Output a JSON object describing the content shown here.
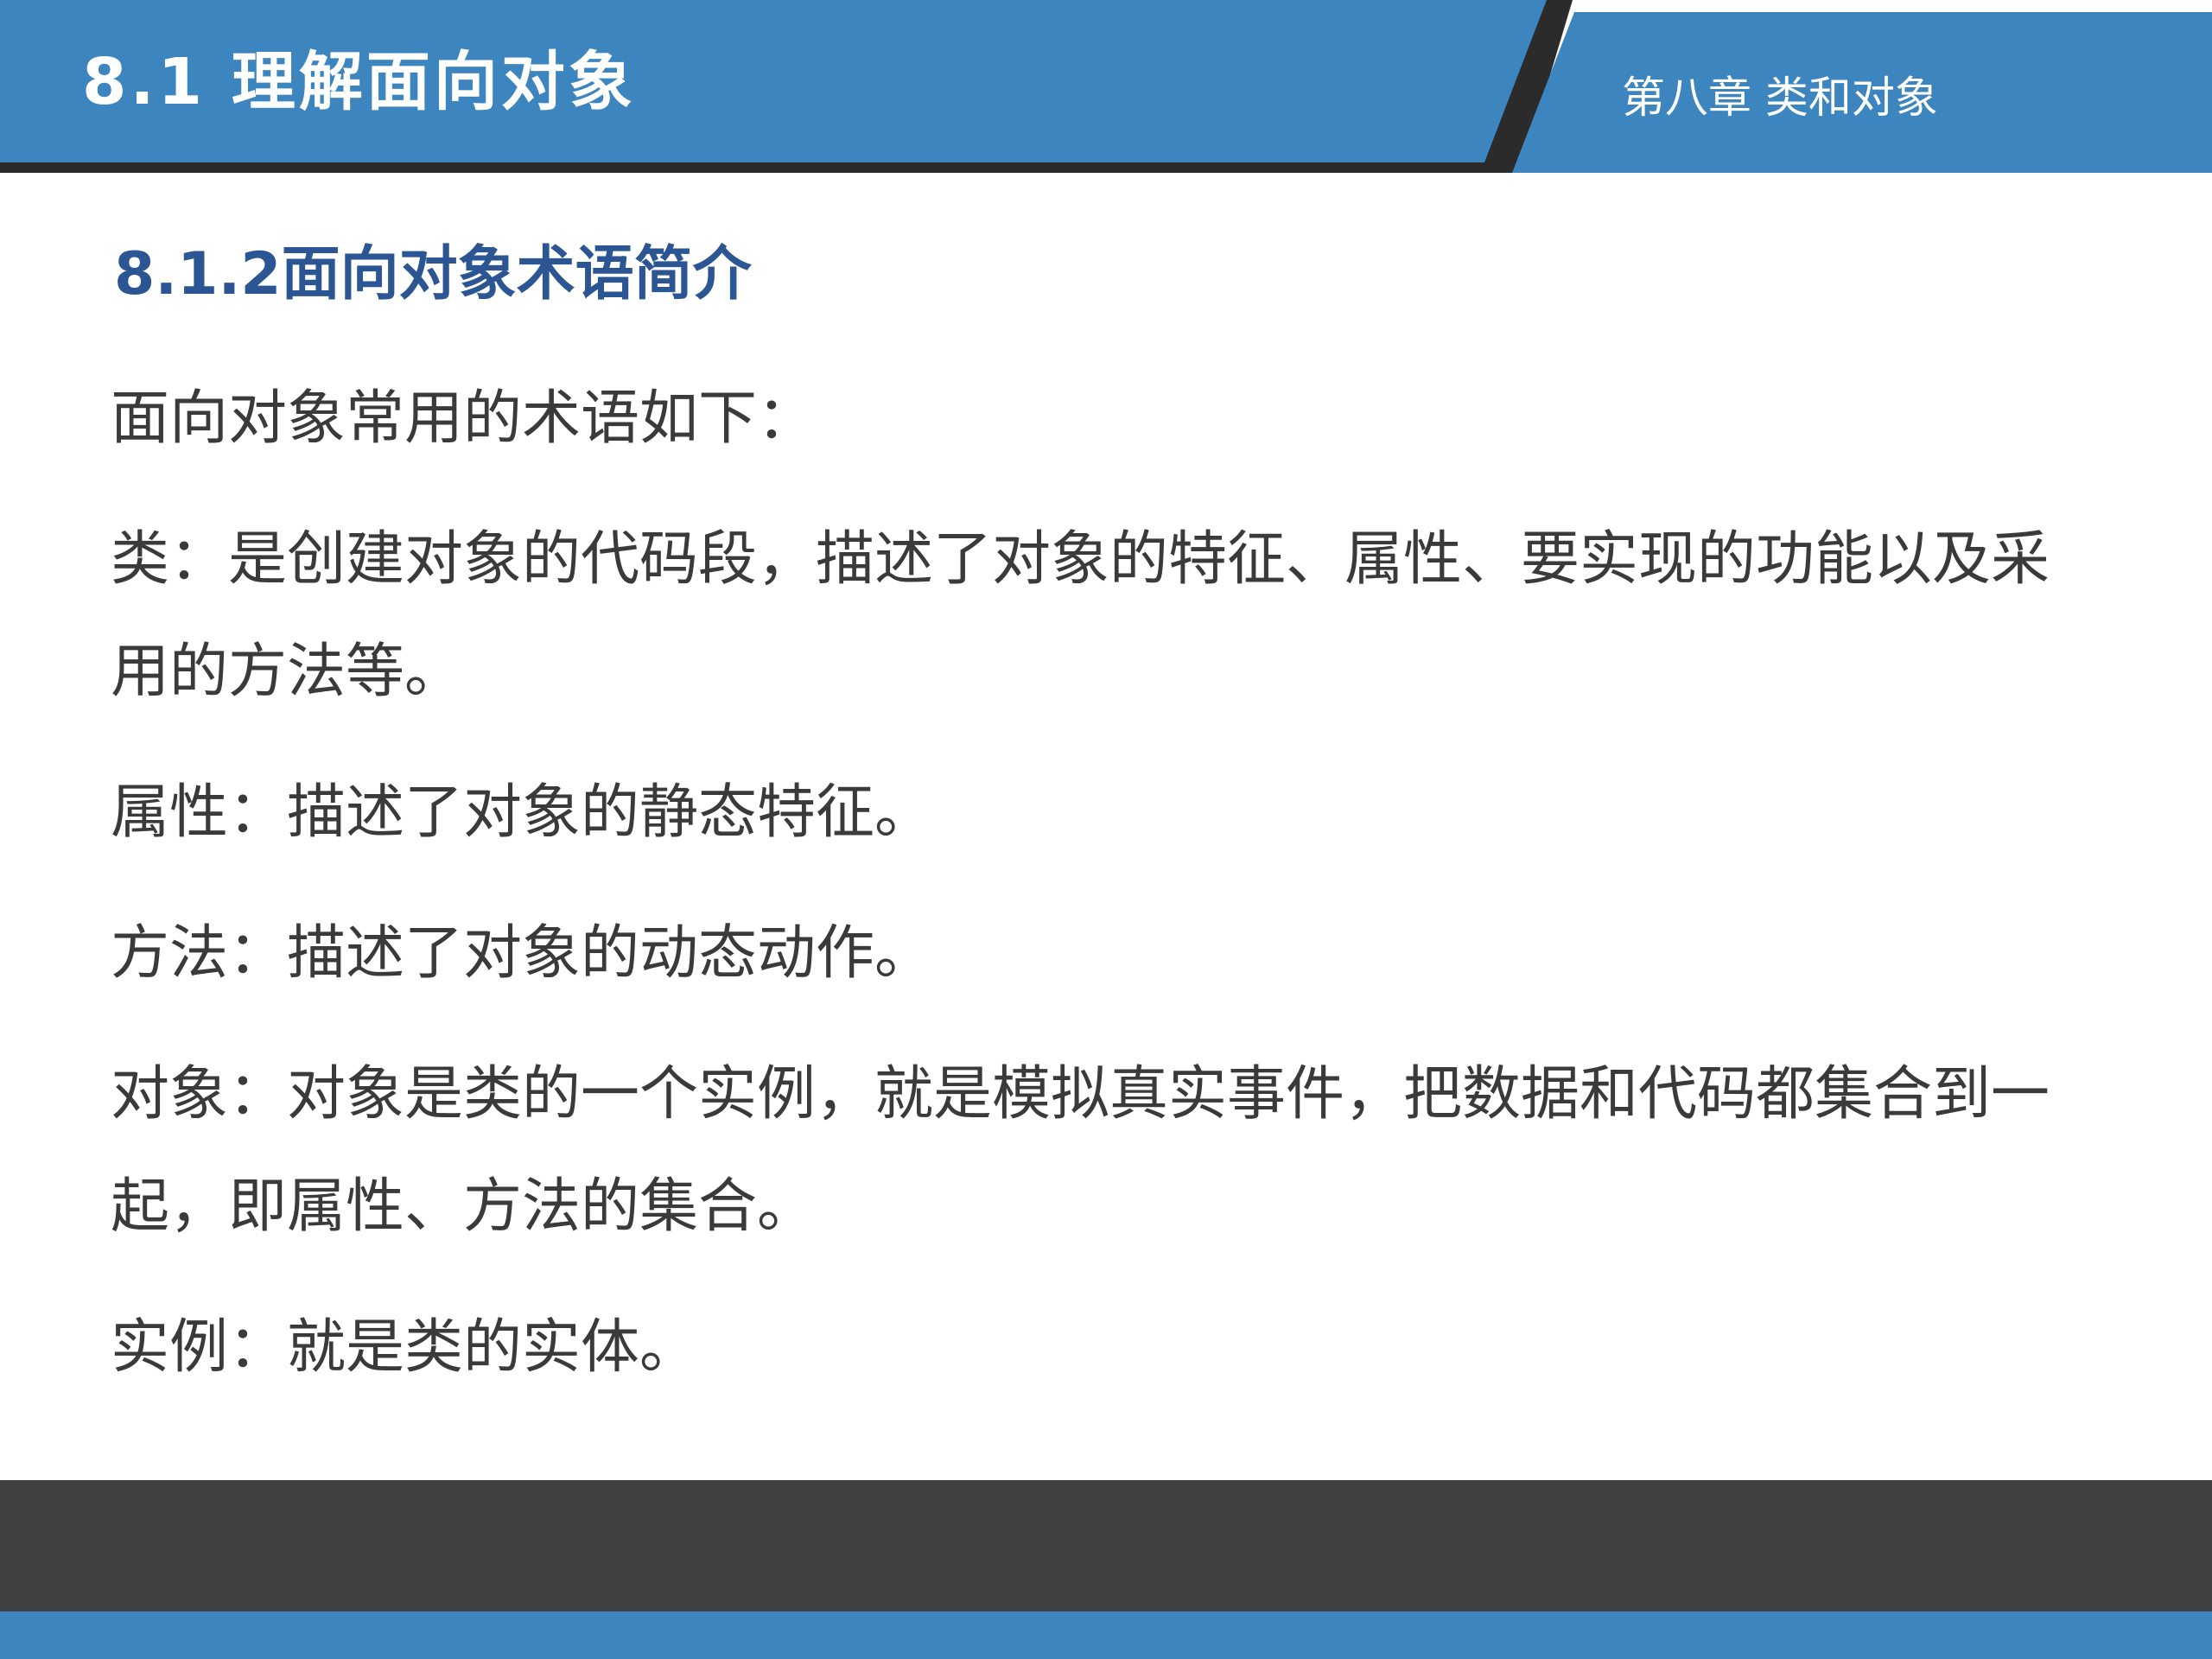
{
  "header": {
    "title": "8.1 理解面向对象",
    "chapter": "第八章 类和对象"
  },
  "section": {
    "heading": "8.1.2面向对象术语简介"
  },
  "content": {
    "intro": "面向对象常用的术语如下：",
    "paragraphs": [
      "类：是创建对象的代码段，描述了对象的特征、属性、要实现的功能以及采用的方法等。",
      "属性：描述了对象的静态特征。",
      "方法：描述了对象的动态动作。",
      "对象：对象是类的一个实例，就是模拟真实事件，把数据和代码都集合到一起，即属性、方法的集合。",
      "实例：就是类的实体。"
    ]
  },
  "colors": {
    "header_blue": "#3d85bf",
    "header_dark": "#2b2b2b",
    "heading_blue": "#2b5593",
    "body_text": "#3a3a3a",
    "footer_dark": "#414141",
    "footer_blue": "#3d85bf"
  }
}
